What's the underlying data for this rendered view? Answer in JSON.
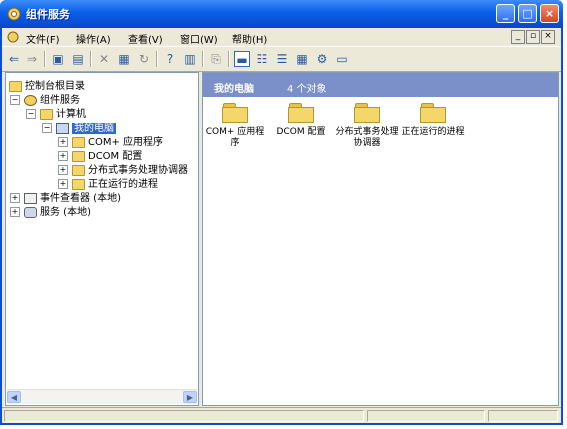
{
  "window": {
    "title": "组件服务"
  },
  "menu": [
    "文件(F)",
    "操作(A)",
    "查看(V)",
    "窗口(W)",
    "帮助(H)"
  ],
  "tree": [
    {
      "label": "控制台根目录",
      "level": 0,
      "expander": "",
      "icon": "folder-icon"
    },
    {
      "label": "组件服务",
      "level": 1,
      "expander": "−",
      "icon": "component-services-icon"
    },
    {
      "label": "计算机",
      "level": 2,
      "expander": "−",
      "icon": "folder-icon"
    },
    {
      "label": "我的电脑",
      "level": 3,
      "expander": "−",
      "icon": "computer-icon",
      "selected": true
    },
    {
      "label": "COM+ 应用程序",
      "level": 4,
      "expander": "+",
      "icon": "folder-icon"
    },
    {
      "label": "DCOM 配置",
      "level": 4,
      "expander": "+",
      "icon": "folder-icon"
    },
    {
      "label": "分布式事务处理协调器",
      "level": 4,
      "expander": "+",
      "icon": "folder-icon"
    },
    {
      "label": "正在运行的进程",
      "level": 4,
      "expander": "+",
      "icon": "folder-icon"
    },
    {
      "label": "事件查看器 (本地)",
      "level": 0,
      "expander": "+",
      "icon": "event-viewer-icon"
    },
    {
      "label": "服务 (本地)",
      "level": 0,
      "expander": "+",
      "icon": "services-icon"
    }
  ],
  "content": {
    "title": "我的电脑",
    "count": "4 个对象",
    "items": [
      {
        "label": "COM+ 应用程序"
      },
      {
        "label": "DCOM 配置"
      },
      {
        "label": "分布式事务处理协调器"
      },
      {
        "label": "正在运行的进程"
      }
    ]
  },
  "colors": {
    "title_blue": "#0a5fe8",
    "header_band": "#7b8fc8",
    "selection": "#316ac5",
    "folder": "#f5d66a"
  }
}
